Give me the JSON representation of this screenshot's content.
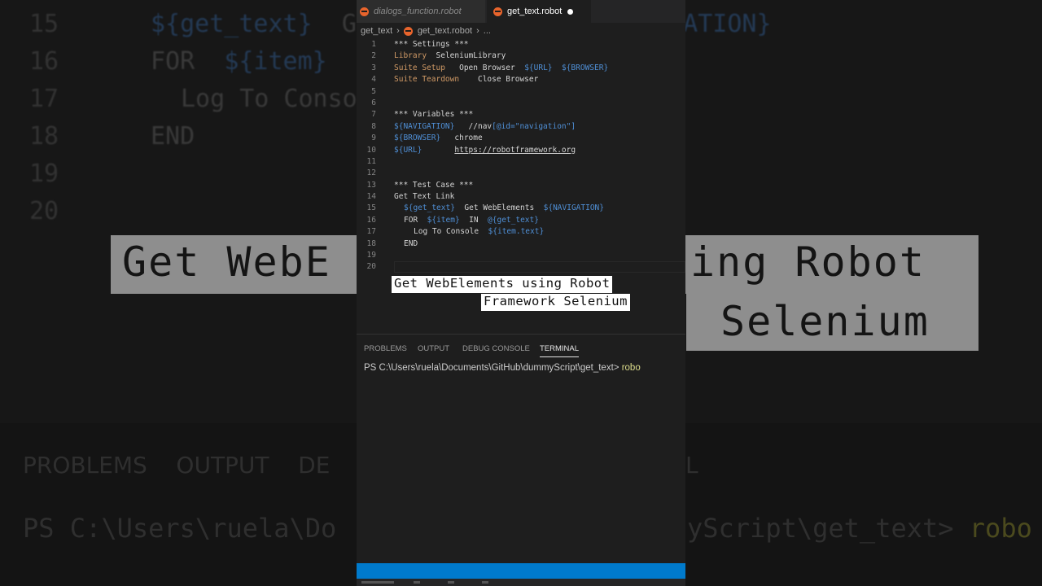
{
  "editor": {
    "tabs": [
      {
        "label": "dialogs_function.robot"
      },
      {
        "label": "get_text.robot"
      }
    ],
    "breadcrumb": {
      "folder": "get_text",
      "file": "get_text.robot",
      "more": "..."
    },
    "lines": {
      "l1": "*** Settings ***",
      "l2a": "Library",
      "l2b": "SeleniumLibrary",
      "l3a": "Suite Setup",
      "l3b": "Open Browser",
      "l3c": "${URL}",
      "l3d": "${BROWSER}",
      "l4a": "Suite Teardown",
      "l4b": "Close Browser",
      "l7": "*** Variables ***",
      "l8a": "${NAVIGATION}",
      "l8b": "//nav",
      "l8c": "[@id=\"navigation\"]",
      "l9a": "${BROWSER}",
      "l9b": "chrome",
      "l10a": "${URL}",
      "l10b": "https://robotframework.org",
      "l13": "*** Test Case ***",
      "l14": "Get Text Link",
      "l15a": "${get_text}",
      "l15b": "Get WebElements",
      "l15c": "${NAVIGATION}",
      "l16a": "FOR",
      "l16b": "${item}",
      "l16c": "IN",
      "l16d": "@{get_text}",
      "l17a": "Log To Console",
      "l17b": "${item.text}",
      "l18": "END"
    },
    "line_numbers": [
      "1",
      "2",
      "3",
      "4",
      "5",
      "6",
      "7",
      "8",
      "9",
      "10",
      "11",
      "12",
      "13",
      "14",
      "15",
      "16",
      "17",
      "18",
      "19",
      "20"
    ]
  },
  "caption": {
    "line1": "Get WebElements using Robot",
    "line2": "Framework Selenium"
  },
  "background": {
    "nums": [
      "15",
      "16",
      "17",
      "18",
      "19",
      "20"
    ],
    "code15a": "${get_text}",
    "code15b": "G",
    "code15c": "NIGATION}",
    "code16a": "FOR",
    "code16b": "${item}",
    "code17": "Log To Conso",
    "code18": "END",
    "banner_left": "Get WebE",
    "banner_right": "ing Robot",
    "banner_right2": "Selenium",
    "tabs": "PROBLEMS    OUTPUT    DE",
    "tabs_right": "L",
    "term_left": "PS C:\\Users\\ruela\\Do",
    "term_right": "yScript\\get_text> ",
    "term_cmd": "robo"
  },
  "panel": {
    "tabs": [
      "PROBLEMS",
      "OUTPUT",
      "DEBUG CONSOLE",
      "TERMINAL"
    ],
    "active_tab": "TERMINAL",
    "prompt": "PS C:\\Users\\ruela\\Documents\\GitHub\\dummyScript\\get_text> ",
    "command": "robo"
  },
  "colors": {
    "accent": "#007acc",
    "robot_icon": "#e8642c",
    "keyword": "#d19a66",
    "variable": "#4f8fd6"
  }
}
